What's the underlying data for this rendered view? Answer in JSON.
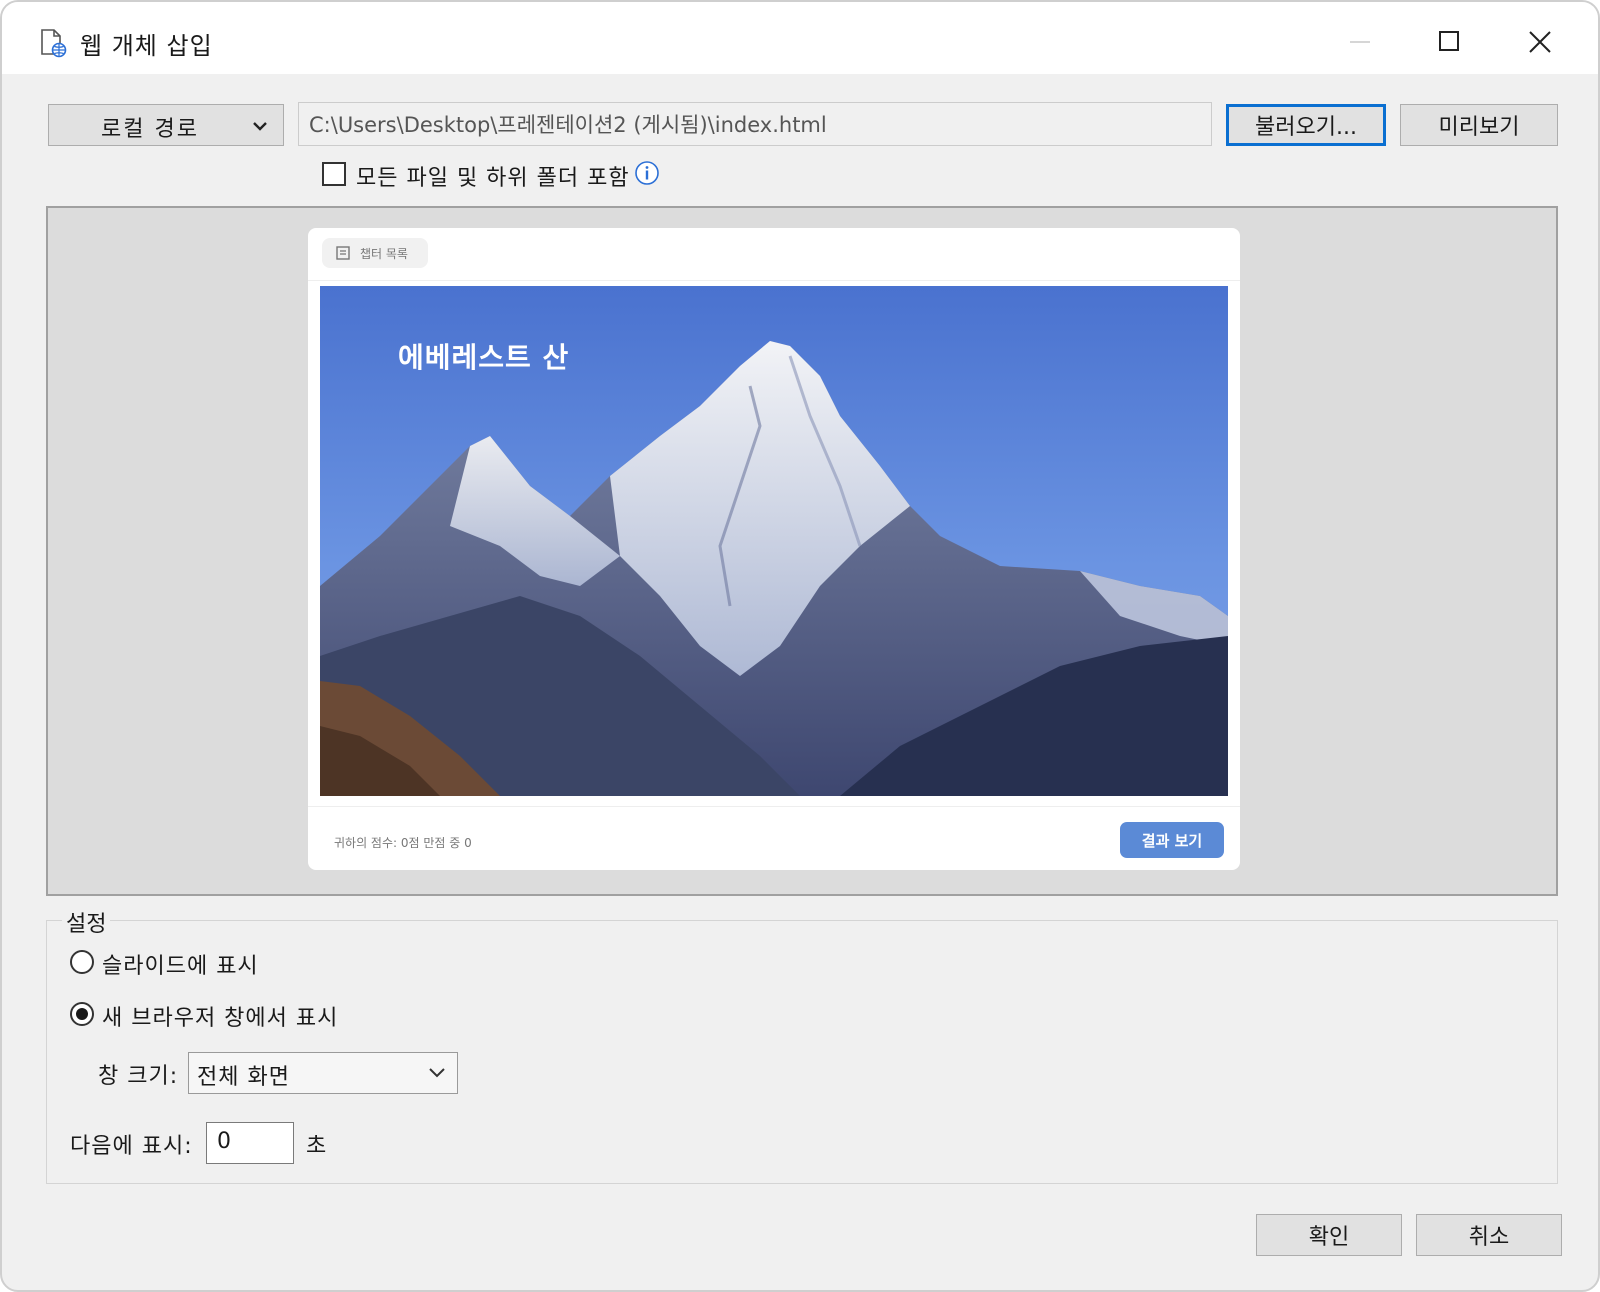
{
  "window": {
    "title": "웹 개체 삽입"
  },
  "source": {
    "type_selected": "로컬 경로",
    "path_value": "C:\\Users\\Desktop\\프레젠테이션2 (게시됨)\\index.html",
    "browse_label": "불러오기...",
    "preview_label": "미리보기",
    "include_subfolders_label": "모든 파일 및 하위 폴더 포함",
    "include_subfolders_checked": false
  },
  "preview": {
    "toc_label": "챕터 목록",
    "slide_title": "에베레스트 산",
    "score_text": "귀하의 점수: 0점 만점 중 0",
    "result_button": "결과 보기",
    "accent_color": "#5b8ad6"
  },
  "settings": {
    "group_label": "설정",
    "options": [
      {
        "label": "슬라이드에 표시",
        "checked": false
      },
      {
        "label": "새 브라우저 창에서 표시",
        "checked": true
      }
    ],
    "window_size_label": "창 크기:",
    "window_size_value": "전체 화면",
    "delay_label": "다음에 표시:",
    "delay_value": "0",
    "delay_unit": "초"
  },
  "footer": {
    "ok_label": "확인",
    "cancel_label": "취소"
  }
}
